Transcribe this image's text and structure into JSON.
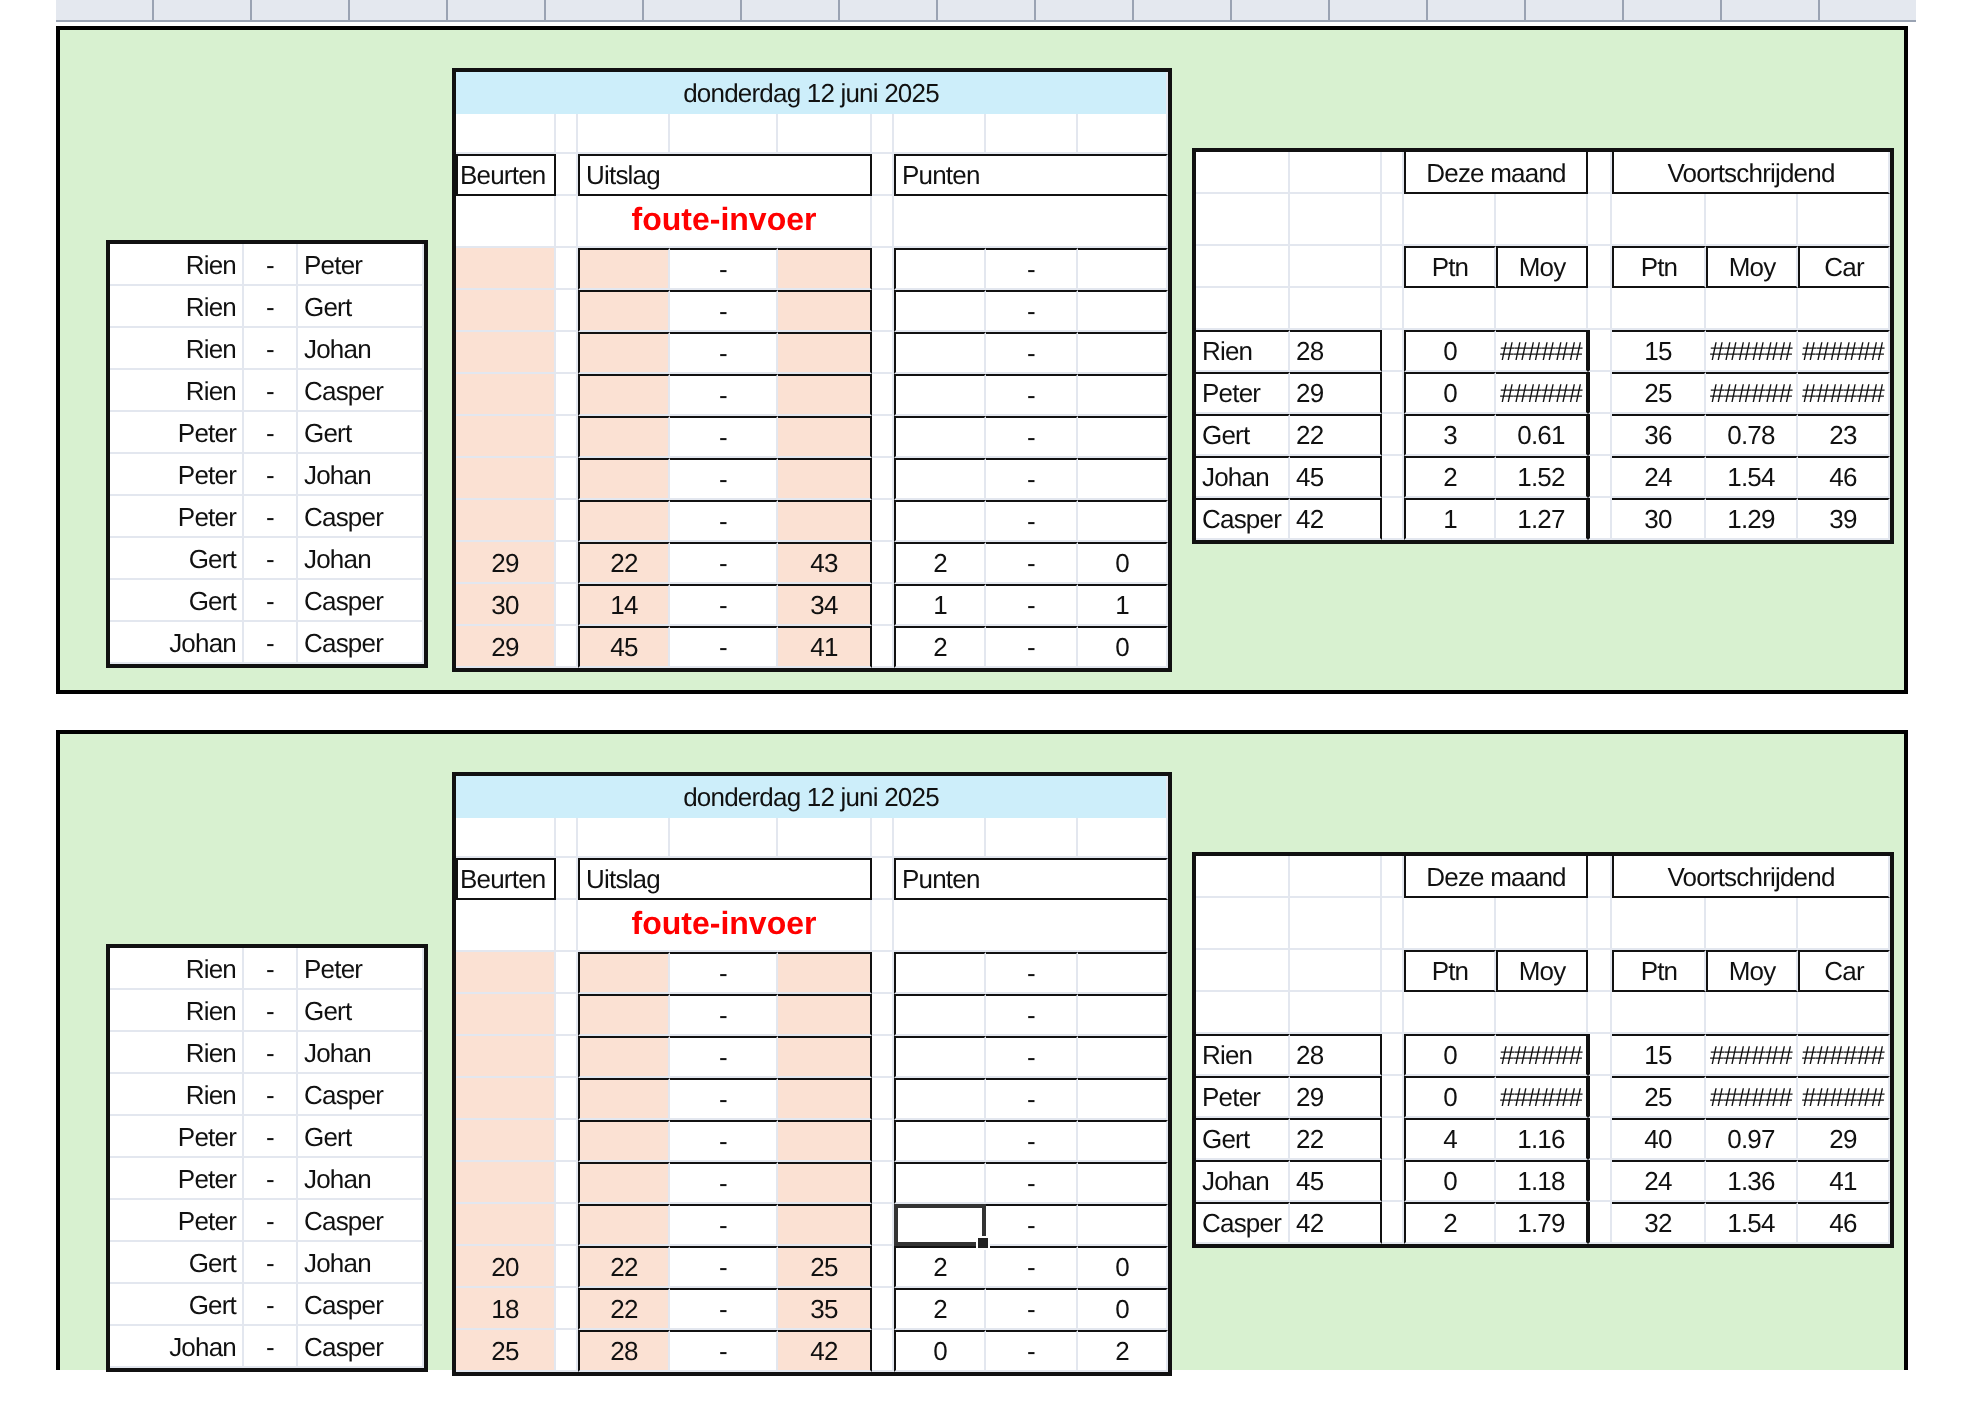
{
  "panels": [
    {
      "date": "donderdag 12 juni 2025",
      "headers": {
        "beurten": "Beurten",
        "uitslag": "Uitslag",
        "punten": "Punten"
      },
      "error": "foute-invoer",
      "matches": [
        {
          "home": "Rien",
          "sep": "-",
          "away": "Peter",
          "score_sep": "-",
          "points_sep": "-",
          "selected": false
        },
        {
          "home": "Rien",
          "sep": "-",
          "away": "Gert",
          "score_sep": "-",
          "points_sep": "-",
          "selected": false
        },
        {
          "home": "Rien",
          "sep": "-",
          "away": "Johan",
          "score_sep": "-",
          "points_sep": "-",
          "selected": false
        },
        {
          "home": "Rien",
          "sep": "-",
          "away": "Casper",
          "score_sep": "-",
          "points_sep": "-",
          "selected": false
        },
        {
          "home": "Peter",
          "sep": "-",
          "away": "Gert",
          "score_sep": "-",
          "points_sep": "-",
          "selected": false
        },
        {
          "home": "Peter",
          "sep": "-",
          "away": "Johan",
          "score_sep": "-",
          "points_sep": "-",
          "selected": false
        },
        {
          "home": "Peter",
          "sep": "-",
          "away": "Casper",
          "score_sep": "-",
          "points_sep": "-",
          "selected": false
        },
        {
          "home": "Gert",
          "sep": "-",
          "away": "Johan",
          "beurten": "29",
          "score_home": "22",
          "score_sep": "-",
          "score_away": "43",
          "points_home": "2",
          "points_sep": "-",
          "points_away": "0",
          "selected": false
        },
        {
          "home": "Gert",
          "sep": "-",
          "away": "Casper",
          "beurten": "30",
          "score_home": "14",
          "score_sep": "-",
          "score_away": "34",
          "points_home": "1",
          "points_sep": "-",
          "points_away": "1",
          "selected": false
        },
        {
          "home": "Johan",
          "sep": "-",
          "away": "Casper",
          "beurten": "29",
          "score_home": "45",
          "score_sep": "-",
          "score_away": "41",
          "points_home": "2",
          "points_sep": "-",
          "points_away": "0",
          "selected": false
        }
      ],
      "standings": {
        "groups": [
          "Deze maand",
          "Voortschrijdend"
        ],
        "columns": [
          "Ptn",
          "Moy",
          "Ptn",
          "Moy",
          "Car"
        ],
        "rows": [
          {
            "name": "Rien",
            "number": "28",
            "values": [
              "0",
              "######",
              "15",
              "######",
              "######"
            ]
          },
          {
            "name": "Peter",
            "number": "29",
            "values": [
              "0",
              "######",
              "25",
              "######",
              "######"
            ]
          },
          {
            "name": "Gert",
            "number": "22",
            "values": [
              "3",
              "0.61",
              "36",
              "0.78",
              "23"
            ]
          },
          {
            "name": "Johan",
            "number": "45",
            "values": [
              "2",
              "1.52",
              "24",
              "1.54",
              "46"
            ]
          },
          {
            "name": "Casper",
            "number": "42",
            "values": [
              "1",
              "1.27",
              "30",
              "1.29",
              "39"
            ]
          }
        ]
      }
    },
    {
      "date": "donderdag 12 juni 2025",
      "headers": {
        "beurten": "Beurten",
        "uitslag": "Uitslag",
        "punten": "Punten"
      },
      "error": "foute-invoer",
      "matches": [
        {
          "home": "Rien",
          "sep": "-",
          "away": "Peter",
          "score_sep": "-",
          "points_sep": "-",
          "selected": false
        },
        {
          "home": "Rien",
          "sep": "-",
          "away": "Gert",
          "score_sep": "-",
          "points_sep": "-",
          "selected": false
        },
        {
          "home": "Rien",
          "sep": "-",
          "away": "Johan",
          "score_sep": "-",
          "points_sep": "-",
          "selected": false
        },
        {
          "home": "Rien",
          "sep": "-",
          "away": "Casper",
          "score_sep": "-",
          "points_sep": "-",
          "selected": false
        },
        {
          "home": "Peter",
          "sep": "-",
          "away": "Gert",
          "score_sep": "-",
          "points_sep": "-",
          "selected": false
        },
        {
          "home": "Peter",
          "sep": "-",
          "away": "Johan",
          "score_sep": "-",
          "points_sep": "-",
          "selected": false
        },
        {
          "home": "Peter",
          "sep": "-",
          "away": "Casper",
          "score_sep": "-",
          "points_sep": "-",
          "selected": true
        },
        {
          "home": "Gert",
          "sep": "-",
          "away": "Johan",
          "beurten": "20",
          "score_home": "22",
          "score_sep": "-",
          "score_away": "25",
          "points_home": "2",
          "points_sep": "-",
          "points_away": "0",
          "selected": false
        },
        {
          "home": "Gert",
          "sep": "-",
          "away": "Casper",
          "beurten": "18",
          "score_home": "22",
          "score_sep": "-",
          "score_away": "35",
          "points_home": "2",
          "points_sep": "-",
          "points_away": "0",
          "selected": false
        },
        {
          "home": "Johan",
          "sep": "-",
          "away": "Casper",
          "beurten": "25",
          "score_home": "28",
          "score_sep": "-",
          "score_away": "42",
          "points_home": "0",
          "points_sep": "-",
          "points_away": "2",
          "selected": false
        }
      ],
      "standings": {
        "groups": [
          "Deze maand",
          "Voortschrijdend"
        ],
        "columns": [
          "Ptn",
          "Moy",
          "Ptn",
          "Moy",
          "Car"
        ],
        "rows": [
          {
            "name": "Rien",
            "number": "28",
            "values": [
              "0",
              "######",
              "15",
              "######",
              "######"
            ]
          },
          {
            "name": "Peter",
            "number": "29",
            "values": [
              "0",
              "######",
              "25",
              "######",
              "######"
            ]
          },
          {
            "name": "Gert",
            "number": "22",
            "values": [
              "4",
              "1.16",
              "40",
              "0.97",
              "29"
            ]
          },
          {
            "name": "Johan",
            "number": "45",
            "values": [
              "0",
              "1.18",
              "24",
              "1.36",
              "41"
            ]
          },
          {
            "name": "Casper",
            "number": "42",
            "values": [
              "2",
              "1.79",
              "32",
              "1.54",
              "46"
            ]
          }
        ]
      }
    }
  ]
}
